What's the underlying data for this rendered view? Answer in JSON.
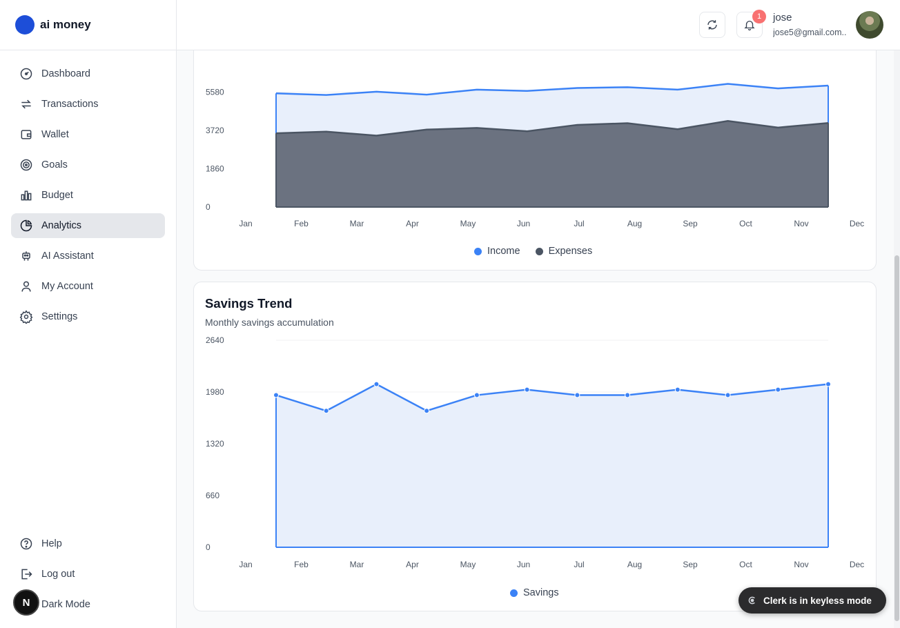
{
  "brand": {
    "name": "ai money"
  },
  "sidebar": {
    "items": [
      {
        "label": "Dashboard",
        "icon": "gauge-icon"
      },
      {
        "label": "Transactions",
        "icon": "arrows-icon"
      },
      {
        "label": "Wallet",
        "icon": "wallet-icon"
      },
      {
        "label": "Goals",
        "icon": "target-icon"
      },
      {
        "label": "Budget",
        "icon": "bar-chart-icon"
      },
      {
        "label": "Analytics",
        "icon": "pie-chart-icon",
        "active": true
      },
      {
        "label": "AI Assistant",
        "icon": "bot-icon"
      },
      {
        "label": "My Account",
        "icon": "user-icon"
      },
      {
        "label": "Settings",
        "icon": "gear-icon"
      }
    ],
    "bottom": [
      {
        "label": "Help",
        "icon": "help-icon"
      },
      {
        "label": "Log out",
        "icon": "logout-icon"
      },
      {
        "label": "Dark Mode",
        "icon": "moon-icon"
      }
    ],
    "dev_badge": "N"
  },
  "header": {
    "notification_count": "1",
    "user_name": "jose",
    "user_email": "jose5@gmail.com.."
  },
  "clerk_toast": "Clerk is in keyless mode",
  "colors": {
    "accent": "#3b82f6",
    "expenses": "#4b5563",
    "income_fill": "#e8effb",
    "expenses_fill": "#6b7280"
  },
  "income_expenses": {
    "legend": {
      "income": "Income",
      "expenses": "Expenses"
    }
  },
  "savings": {
    "title": "Savings Trend",
    "subtitle": "Monthly savings accumulation",
    "legend": {
      "savings": "Savings"
    }
  },
  "chart_data": [
    {
      "type": "area",
      "categories": [
        "Jan",
        "Feb",
        "Mar",
        "Apr",
        "May",
        "Jun",
        "Jul",
        "Aug",
        "Sep",
        "Oct",
        "Nov",
        "Dec"
      ],
      "y_ticks": [
        "0",
        "1860",
        "3720",
        "5580"
      ],
      "ylim": [
        0,
        7440
      ],
      "series": [
        {
          "name": "Income",
          "values": [
            5520,
            5440,
            5600,
            5460,
            5700,
            5640,
            5780,
            5820,
            5700,
            5980,
            5760,
            5900
          ]
        },
        {
          "name": "Expenses",
          "values": [
            3580,
            3660,
            3470,
            3760,
            3840,
            3680,
            3990,
            4070,
            3780,
            4180,
            3860,
            4080
          ]
        }
      ],
      "legend": "bottom",
      "grid": true
    },
    {
      "type": "area",
      "title": "Savings Trend",
      "categories": [
        "Jan",
        "Feb",
        "Mar",
        "Apr",
        "May",
        "Jun",
        "Jul",
        "Aug",
        "Sep",
        "Oct",
        "Nov",
        "Dec"
      ],
      "y_ticks": [
        "0",
        "660",
        "1320",
        "1980",
        "2640"
      ],
      "ylim": [
        0,
        2640
      ],
      "series": [
        {
          "name": "Savings",
          "values": [
            1940,
            1740,
            2080,
            1740,
            1940,
            2010,
            1940,
            1940,
            2010,
            1940,
            2010,
            2080
          ]
        }
      ],
      "legend": "bottom",
      "grid": true
    }
  ]
}
